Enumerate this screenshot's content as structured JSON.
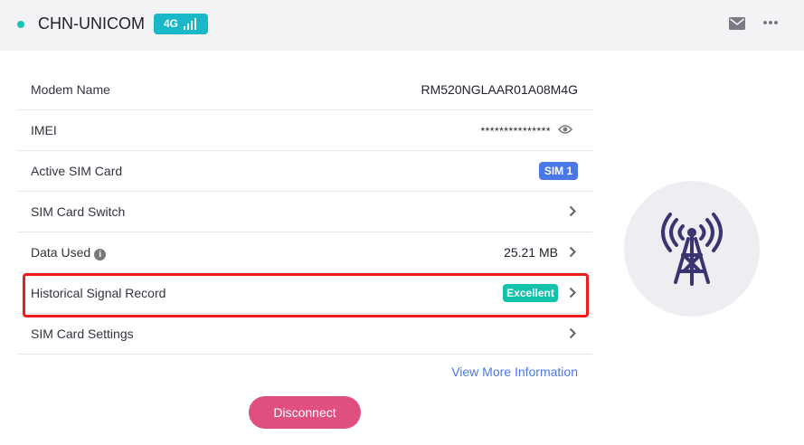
{
  "header": {
    "carrier": "CHN-UNICOM",
    "network_type": "4G",
    "icons": {
      "status": "status-dot",
      "signal": "signal-bars-icon",
      "mail": "mail-icon",
      "more": "more-icon"
    },
    "colors": {
      "status_dot": "#18c2b0",
      "network_badge": "#18b8c9"
    }
  },
  "rows": {
    "modem_name": {
      "label": "Modem Name",
      "value": "RM520NGLAAR01A08M4G"
    },
    "imei": {
      "label": "IMEI",
      "value": "***************"
    },
    "active_sim": {
      "label": "Active SIM Card",
      "value": "SIM 1"
    },
    "sim_switch": {
      "label": "SIM Card Switch"
    },
    "data_used": {
      "label": "Data Used",
      "value": "25.21 MB"
    },
    "signal_record": {
      "label": "Historical Signal Record",
      "value": "Excellent"
    },
    "sim_settings": {
      "label": "SIM Card Settings"
    }
  },
  "links": {
    "view_more": "View More Information"
  },
  "actions": {
    "disconnect": "Disconnect"
  },
  "colors": {
    "accent_blue": "#4b78e8",
    "excellent_green": "#12c2ab",
    "disconnect_pink": "#e0507f",
    "highlight_red": "#ee1c1c",
    "tower": "#3a3570"
  }
}
